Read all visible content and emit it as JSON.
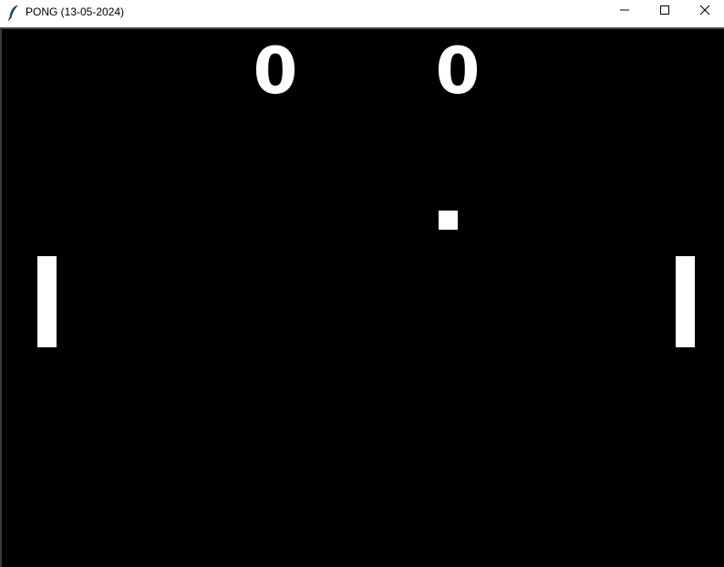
{
  "window": {
    "title": "PONG (13-05-2024)",
    "icon": "feather-icon",
    "controls": {
      "minimize_icon": "minimize-icon",
      "maximize_icon": "maximize-icon",
      "close_icon": "close-icon"
    }
  },
  "game": {
    "background_color": "#000000",
    "foreground_color": "#ffffff",
    "score_left": "0",
    "score_right": "0"
  }
}
